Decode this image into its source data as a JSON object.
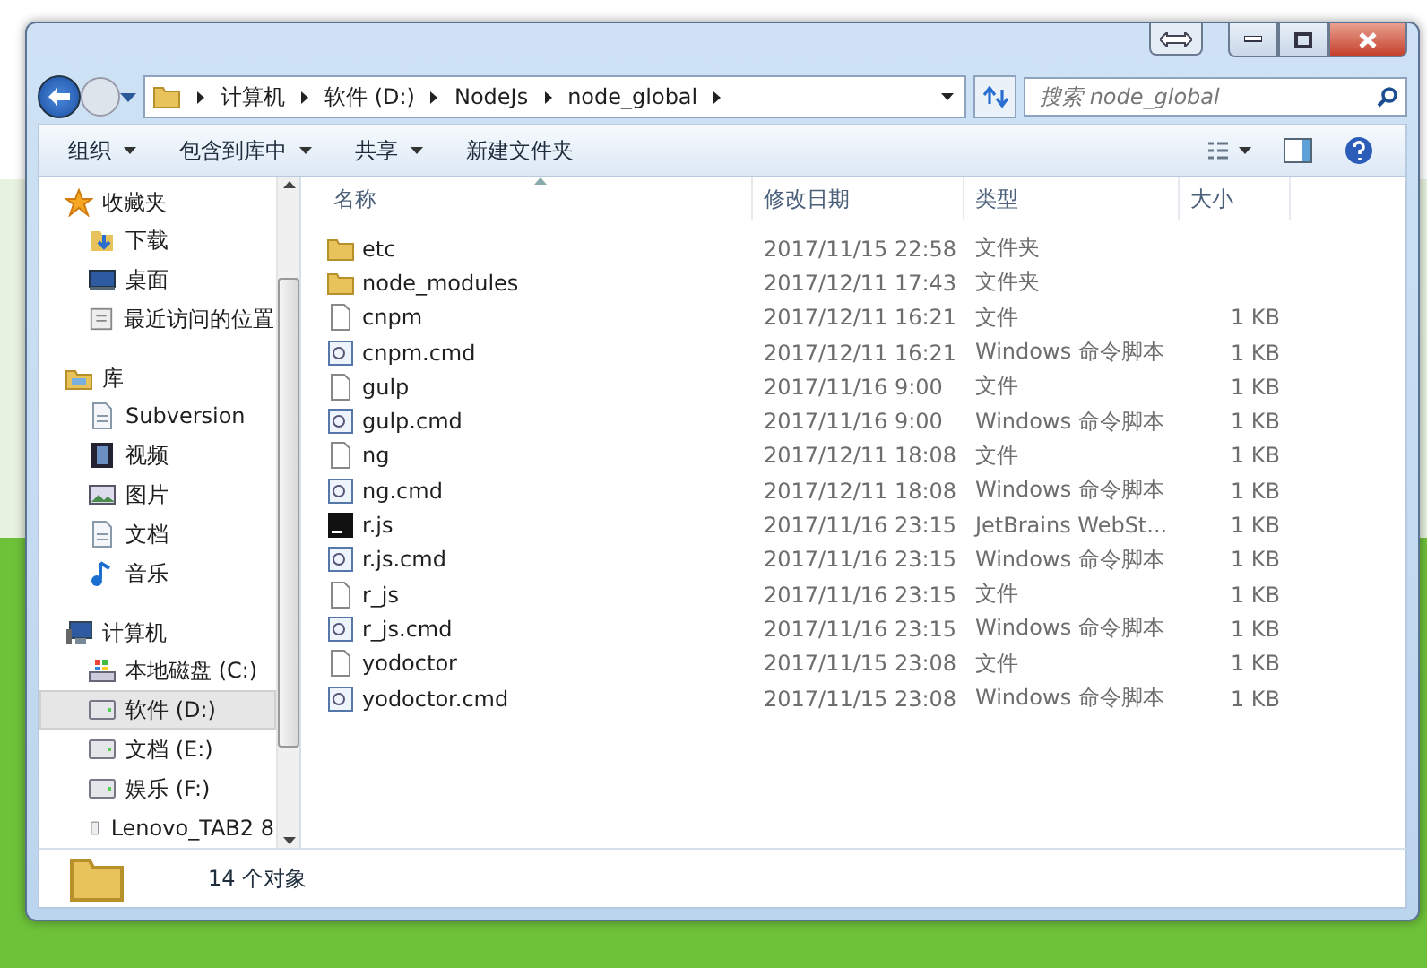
{
  "address": {
    "crumbs": [
      "计算机",
      "软件 (D:)",
      "NodeJs",
      "node_global"
    ]
  },
  "search": {
    "placeholder": "搜索 node_global"
  },
  "toolbar": {
    "buttons": [
      {
        "label": "组织",
        "dropdown": true
      },
      {
        "label": "包含到库中",
        "dropdown": true
      },
      {
        "label": "共享",
        "dropdown": true
      },
      {
        "label": "新建文件夹",
        "dropdown": false
      }
    ]
  },
  "nav": {
    "groups": [
      {
        "label": "收藏夹",
        "kind": "star",
        "items": [
          {
            "label": "下载",
            "kind": "download",
            "selected": false
          },
          {
            "label": "桌面",
            "kind": "desktop",
            "selected": false
          },
          {
            "label": "最近访问的位置",
            "kind": "recent",
            "selected": false
          }
        ]
      },
      {
        "label": "库",
        "kind": "library",
        "items": [
          {
            "label": "Subversion",
            "kind": "doc",
            "selected": false
          },
          {
            "label": "视频",
            "kind": "video",
            "selected": false
          },
          {
            "label": "图片",
            "kind": "picture",
            "selected": false
          },
          {
            "label": "文档",
            "kind": "doc",
            "selected": false
          },
          {
            "label": "音乐",
            "kind": "music",
            "selected": false
          }
        ]
      },
      {
        "label": "计算机",
        "kind": "computer",
        "items": [
          {
            "label": "本地磁盘 (C:)",
            "kind": "sysdrive",
            "selected": false
          },
          {
            "label": "软件 (D:)",
            "kind": "drive",
            "selected": true
          },
          {
            "label": "文档 (E:)",
            "kind": "drive",
            "selected": false
          },
          {
            "label": "娱乐 (F:)",
            "kind": "drive",
            "selected": false
          },
          {
            "label": "Lenovo_TAB2 8",
            "kind": "device",
            "selected": false
          }
        ]
      }
    ]
  },
  "table": {
    "columns": [
      "名称",
      "修改日期",
      "类型",
      "大小"
    ],
    "rows": [
      {
        "kind": "folder",
        "name": "etc",
        "date": "2017/11/15 22:58",
        "type": "文件夹"
      },
      {
        "kind": "folder",
        "name": "node_modules",
        "date": "2017/12/11 17:43",
        "type": "文件夹"
      },
      {
        "kind": "file",
        "name": "cnpm",
        "date": "2017/12/11 16:21",
        "type": "文件",
        "size": "1 KB"
      },
      {
        "kind": "cmd",
        "name": "cnpm.cmd",
        "date": "2017/12/11 16:21",
        "type": "Windows 命令脚本",
        "size": "1 KB"
      },
      {
        "kind": "file",
        "name": "gulp",
        "date": "2017/11/16 9:00",
        "type": "文件",
        "size": "1 KB"
      },
      {
        "kind": "cmd",
        "name": "gulp.cmd",
        "date": "2017/11/16 9:00",
        "type": "Windows 命令脚本",
        "size": "1 KB"
      },
      {
        "kind": "file",
        "name": "ng",
        "date": "2017/12/11 18:08",
        "type": "文件",
        "size": "1 KB"
      },
      {
        "kind": "cmd",
        "name": "ng.cmd",
        "date": "2017/12/11 18:08",
        "type": "Windows 命令脚本",
        "size": "1 KB"
      },
      {
        "kind": "ws",
        "name": "r.js",
        "date": "2017/11/16 23:15",
        "type": "JetBrains WebSt...",
        "size": "1 KB"
      },
      {
        "kind": "cmd",
        "name": "r.js.cmd",
        "date": "2017/11/16 23:15",
        "type": "Windows 命令脚本",
        "size": "1 KB"
      },
      {
        "kind": "file",
        "name": "r_js",
        "date": "2017/11/16 23:15",
        "type": "文件",
        "size": "1 KB"
      },
      {
        "kind": "cmd",
        "name": "r_js.cmd",
        "date": "2017/11/16 23:15",
        "type": "Windows 命令脚本",
        "size": "1 KB"
      },
      {
        "kind": "file",
        "name": "yodoctor",
        "date": "2017/11/15 23:08",
        "type": "文件",
        "size": "1 KB"
      },
      {
        "kind": "cmd",
        "name": "yodoctor.cmd",
        "date": "2017/11/15 23:08",
        "type": "Windows 命令脚本",
        "size": "1 KB"
      }
    ]
  },
  "status_bar": {
    "count": "14 个对象"
  }
}
